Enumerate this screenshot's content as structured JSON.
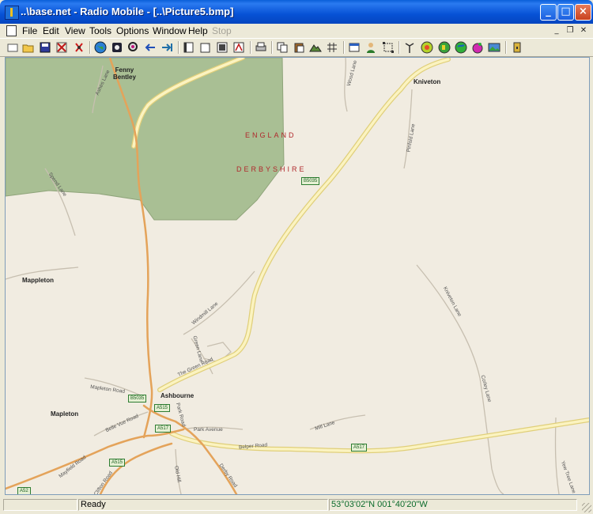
{
  "window": {
    "title": "..\\base.net - Radio Mobile - [..\\Picture5.bmp]",
    "controls": {
      "minimize": "minimize",
      "maximize": "maximize",
      "close": "close"
    }
  },
  "menu": {
    "items": [
      {
        "label": "File",
        "enabled": true
      },
      {
        "label": "Edit",
        "enabled": true
      },
      {
        "label": "View",
        "enabled": true
      },
      {
        "label": "Tools",
        "enabled": true
      },
      {
        "label": "Options",
        "enabled": true
      },
      {
        "label": "Window",
        "enabled": true
      },
      {
        "label": "Help",
        "enabled": true
      },
      {
        "label": "Stop",
        "enabled": false
      }
    ]
  },
  "toolbar": {
    "icons": [
      "new-icon",
      "open-icon",
      "save-icon",
      "scissors-icon",
      "unit-icon",
      "globe-icon",
      "network-icon",
      "search-icon",
      "back-arrow-icon",
      "forward-arrow-icon",
      "window-icon",
      "new-window-icon",
      "copy-window-icon",
      "pdf-icon",
      "print-icon",
      "copy-icon",
      "paste-icon",
      "terrain-icon",
      "grid-icon",
      "map-window-icon",
      "person-icon",
      "select-icon",
      "antenna-icon",
      "coverage-icon",
      "map-globe-icon",
      "world-icon",
      "palette-icon",
      "picture-icon",
      "exit-icon"
    ]
  },
  "map": {
    "towns": [
      "Fenny\nBentley",
      "Kniveton",
      "Mappleton",
      "Mapleton",
      "Ashbourne"
    ],
    "regions": [
      "ENGLAND",
      "DERBYSHIRE"
    ],
    "roads": [
      "B5035",
      "B5035",
      "A515",
      "A517",
      "A515",
      "A517",
      "A52"
    ],
    "lanes": [
      "Ashes Lane",
      "Wood Lane",
      "Pinfold Lane",
      "Spend Lane",
      "Windmill Lane",
      "Green Lane",
      "The Green Road",
      "Mapleton Road",
      "Belle Vue Road",
      "Park Road",
      "Park Avenue",
      "Mill Lane",
      "Belper Road",
      "Mayfield Road",
      "Old Hill",
      "Derby Road",
      "Kniveton Lane",
      "Corley Lane",
      "Yew Tree Lane",
      "Clifton Road"
    ]
  },
  "status": {
    "text": "Ready",
    "coords": "53°03'02\"N 001°40'20\"W"
  }
}
